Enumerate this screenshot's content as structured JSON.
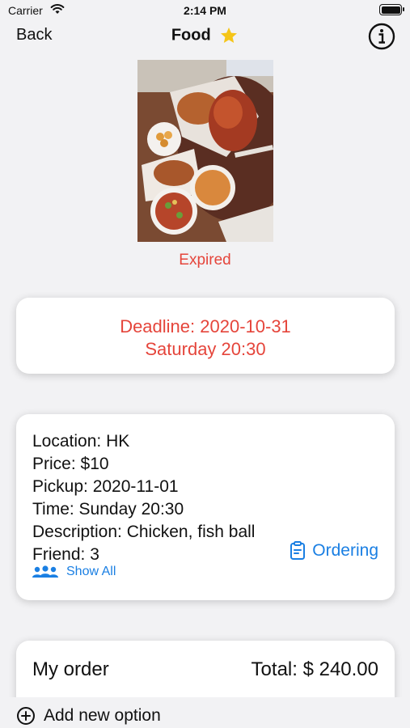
{
  "status_bar": {
    "carrier": "Carrier",
    "time": "2:14 PM",
    "icons": [
      "wifi-icon",
      "battery-icon"
    ]
  },
  "nav": {
    "back_label": "Back",
    "title": "Food",
    "icons": [
      "star-icon",
      "info-icon"
    ]
  },
  "photo": {
    "icon": "food-photo"
  },
  "status_text": "Expired",
  "deadline": {
    "line1": "Deadline: 2020-10-31",
    "line2": "Saturday 20:30"
  },
  "details": {
    "location": "Location: HK",
    "price": "Price: $10",
    "pickup": "Pickup: 2020-11-01",
    "time": "Time: Sunday 20:30",
    "description": "Description: Chicken, fish ball",
    "friend": "Friend: 3",
    "ordering_label": "Ordering",
    "show_all_label": "Show All"
  },
  "order": {
    "title": "My order",
    "total": "Total: $ 240.00"
  },
  "bottom": {
    "add_option_label": "Add new option"
  },
  "colors": {
    "accent_blue": "#1a7fe3",
    "alert_red": "#e5453b",
    "background": "#f2f2f4",
    "star": "#f5c518"
  }
}
